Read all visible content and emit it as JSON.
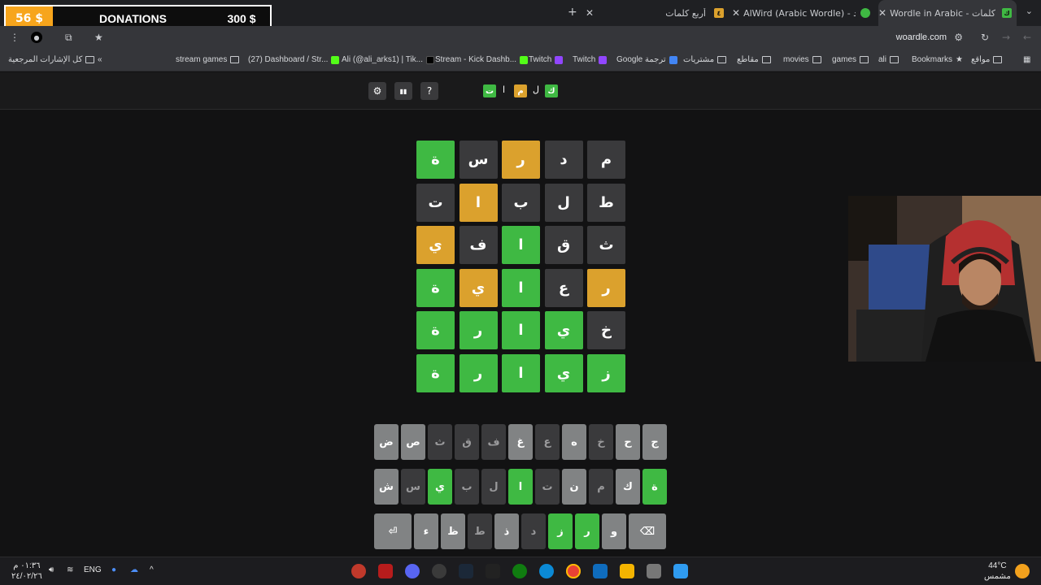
{
  "tabs": [
    {
      "title": "Wordle in Arabic - كلمات",
      "active": true,
      "favicon_color": "#3fb943"
    },
    {
      "title": "AlWird (Arabic Wordle) - الورد",
      "active": false,
      "favicon_color": "#3fb943"
    },
    {
      "title": "أربع كلمات",
      "active": false,
      "favicon_color": "#dba12d"
    }
  ],
  "address_bar": {
    "url": "woardle.com"
  },
  "donations": {
    "left_amount": "56 $",
    "title": "DONATIONS",
    "right_amount": "300 $"
  },
  "bookmarks": {
    "all_bookmarks": "كل الإشارات المرجعية",
    "items": [
      "stream games",
      "(27) Dashboard / Str...",
      "Ali (@ali_arks1) | Tik...",
      "Stream - Kick Dashb...",
      "Twitch",
      "Twitch",
      "Google ترجمة",
      "مشتريات",
      "مقاطع",
      "movies",
      "games",
      "ali",
      "Bookmarks",
      "مواقع"
    ]
  },
  "header": {
    "logo_tiles": [
      {
        "char": "ك",
        "color": "#3fb943"
      },
      {
        "char": "ل",
        "color": "none"
      },
      {
        "char": "م",
        "color": "#dba12d"
      },
      {
        "char": "ا",
        "color": "none"
      },
      {
        "char": "ت",
        "color": "#3fb943"
      }
    ],
    "help_label": "?",
    "stats_label": "▮▮",
    "settings_label": "⚙"
  },
  "board": {
    "rows": [
      [
        {
          "l": "ة",
          "s": "g"
        },
        {
          "l": "س",
          "s": "d"
        },
        {
          "l": "ر",
          "s": "y"
        },
        {
          "l": "د",
          "s": "d"
        },
        {
          "l": "م",
          "s": "d"
        }
      ],
      [
        {
          "l": "ت",
          "s": "d"
        },
        {
          "l": "ا",
          "s": "y"
        },
        {
          "l": "ب",
          "s": "d"
        },
        {
          "l": "ل",
          "s": "d"
        },
        {
          "l": "ط",
          "s": "d"
        }
      ],
      [
        {
          "l": "ي",
          "s": "y"
        },
        {
          "l": "ف",
          "s": "d"
        },
        {
          "l": "ا",
          "s": "g"
        },
        {
          "l": "ق",
          "s": "d"
        },
        {
          "l": "ث",
          "s": "d"
        }
      ],
      [
        {
          "l": "ة",
          "s": "g"
        },
        {
          "l": "ي",
          "s": "y"
        },
        {
          "l": "ا",
          "s": "g"
        },
        {
          "l": "ع",
          "s": "d"
        },
        {
          "l": "ر",
          "s": "y"
        }
      ],
      [
        {
          "l": "ة",
          "s": "g"
        },
        {
          "l": "ر",
          "s": "g"
        },
        {
          "l": "ا",
          "s": "g"
        },
        {
          "l": "ي",
          "s": "g"
        },
        {
          "l": "خ",
          "s": "d"
        }
      ],
      [
        {
          "l": "ة",
          "s": "g"
        },
        {
          "l": "ر",
          "s": "g"
        },
        {
          "l": "ا",
          "s": "g"
        },
        {
          "l": "ي",
          "s": "g"
        },
        {
          "l": "ز",
          "s": "g"
        }
      ]
    ]
  },
  "keyboard": {
    "row1": [
      {
        "k": "ض",
        "s": "light"
      },
      {
        "k": "ص",
        "s": "light"
      },
      {
        "k": "ث",
        "s": "dark"
      },
      {
        "k": "ق",
        "s": "dark"
      },
      {
        "k": "ف",
        "s": "dark"
      },
      {
        "k": "غ",
        "s": "light"
      },
      {
        "k": "ع",
        "s": "dark"
      },
      {
        "k": "ه",
        "s": "light"
      },
      {
        "k": "خ",
        "s": "dark"
      },
      {
        "k": "ح",
        "s": "light"
      },
      {
        "k": "ج",
        "s": "light"
      }
    ],
    "row2": [
      {
        "k": "ش",
        "s": "light"
      },
      {
        "k": "س",
        "s": "dark"
      },
      {
        "k": "ي",
        "s": "green"
      },
      {
        "k": "ب",
        "s": "dark"
      },
      {
        "k": "ل",
        "s": "dark"
      },
      {
        "k": "ا",
        "s": "green"
      },
      {
        "k": "ت",
        "s": "dark"
      },
      {
        "k": "ن",
        "s": "light"
      },
      {
        "k": "م",
        "s": "dark"
      },
      {
        "k": "ك",
        "s": "light"
      },
      {
        "k": "ة",
        "s": "green"
      }
    ],
    "row3": [
      {
        "k": "⏎",
        "s": "light",
        "w": "wide"
      },
      {
        "k": "ء",
        "s": "light"
      },
      {
        "k": "ظ",
        "s": "light"
      },
      {
        "k": "ط",
        "s": "dark"
      },
      {
        "k": "ذ",
        "s": "light"
      },
      {
        "k": "د",
        "s": "dark"
      },
      {
        "k": "ز",
        "s": "green"
      },
      {
        "k": "ر",
        "s": "green"
      },
      {
        "k": "و",
        "s": "light"
      },
      {
        "k": "⌫",
        "s": "light",
        "w": "wide"
      }
    ]
  },
  "taskbar": {
    "time": "٠١:٣٦ م",
    "date": "٢٤/٠٢/٢٦",
    "lang": "ENG",
    "weather_temp": "44°C",
    "weather_desc": "مشمس"
  }
}
